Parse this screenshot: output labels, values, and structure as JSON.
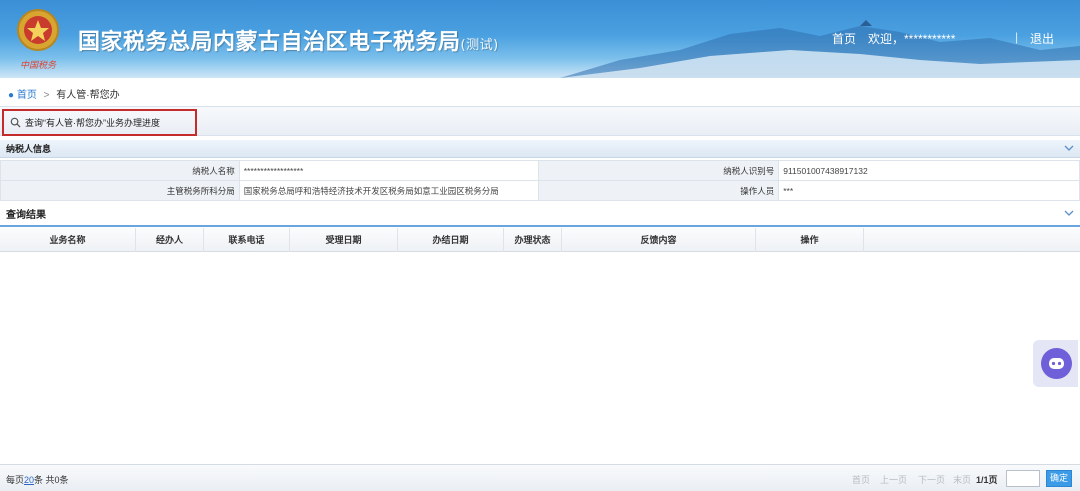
{
  "header": {
    "title": "国家税务总局内蒙古自治区电子税务局",
    "title_suffix": "(测试)",
    "emblem_signature": "中国税务",
    "nav_home": "首页",
    "nav_welcome": "欢迎，***********",
    "nav_separator": "|",
    "nav_logout": "退出"
  },
  "breadcrumb": {
    "home": "首页",
    "separator": ">",
    "current": "有人管·帮您办"
  },
  "toolbar": {
    "query_button": "查询“有人管·帮您办”业务办理进度"
  },
  "taxpayer_section": {
    "title": "纳税人信息",
    "rows": [
      {
        "label1": "纳税人名称",
        "value1": "******************",
        "label2": "纳税人识别号",
        "value2": "91150100743891713​2"
      },
      {
        "label1": "主管税务所科分局",
        "value1": "国家税务总局呼和浩特经济技术开发区税务局如意工业园区税务分局",
        "label2": "操作人员",
        "value2": "***"
      }
    ]
  },
  "results_section": {
    "title": "查询结果",
    "columns": [
      "业务名称",
      "经办人",
      "联系电话",
      "受理日期",
      "办结日期",
      "办理状态",
      "反馈内容",
      "操作"
    ]
  },
  "footer": {
    "per_page_prefix": "每页",
    "per_page_value": "20",
    "per_page_suffix": "条 共0条",
    "first": "首页",
    "prev": "上一页",
    "next": "下一页",
    "last": "末页",
    "page_info": "1/1页",
    "go": "确定"
  },
  "colors": {
    "header_blue": "#3b8fd6",
    "highlight_red": "#c42b2b",
    "link_blue": "#2a7bd0",
    "assistant_purple": "#6f5fd8"
  },
  "icons": [
    "emblem-icon",
    "location-pin-icon",
    "search-icon",
    "chevron-down-icon",
    "chat-assistant-icon"
  ]
}
